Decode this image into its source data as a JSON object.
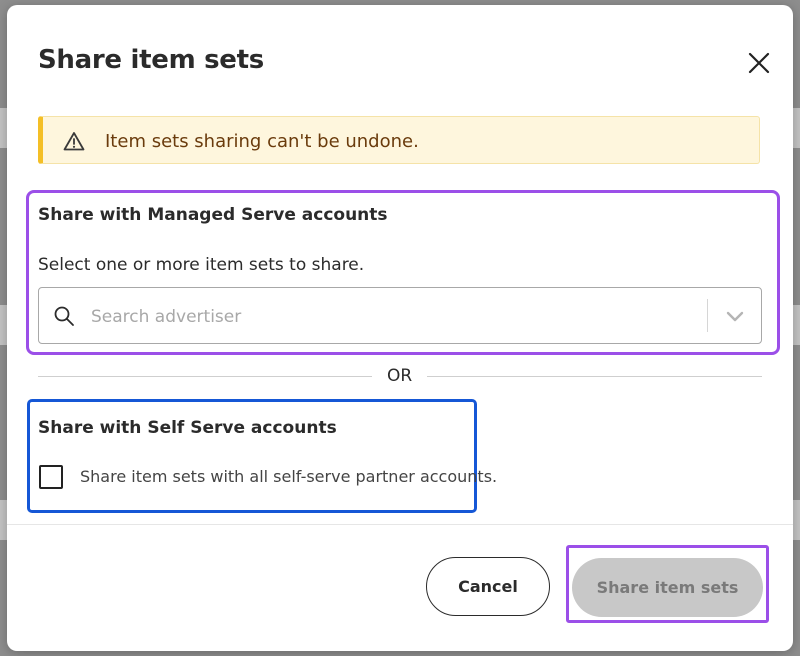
{
  "modal": {
    "title": "Share item sets",
    "warning": "Item sets sharing can't be undone."
  },
  "managed": {
    "title": "Share with Managed Serve accounts",
    "description": "Select one or more item sets to share.",
    "search_placeholder": "Search advertiser",
    "search_value": ""
  },
  "separator_text": "OR",
  "self_serve": {
    "title": "Share with Self Serve accounts",
    "checkbox_label": "Share item sets with all self-serve partner accounts.",
    "checked": false
  },
  "footer": {
    "cancel_label": "Cancel",
    "share_label": "Share item sets",
    "share_disabled": true
  },
  "colors": {
    "warning_bg": "#fef6dd",
    "warning_accent": "#f4bf26",
    "highlight_purple": "#9b4fe8",
    "highlight_blue": "#1557d6",
    "disabled_button": "#c8c8c8"
  },
  "icons": [
    "warning-icon",
    "close-icon",
    "search-icon",
    "chevron-down-icon"
  ]
}
